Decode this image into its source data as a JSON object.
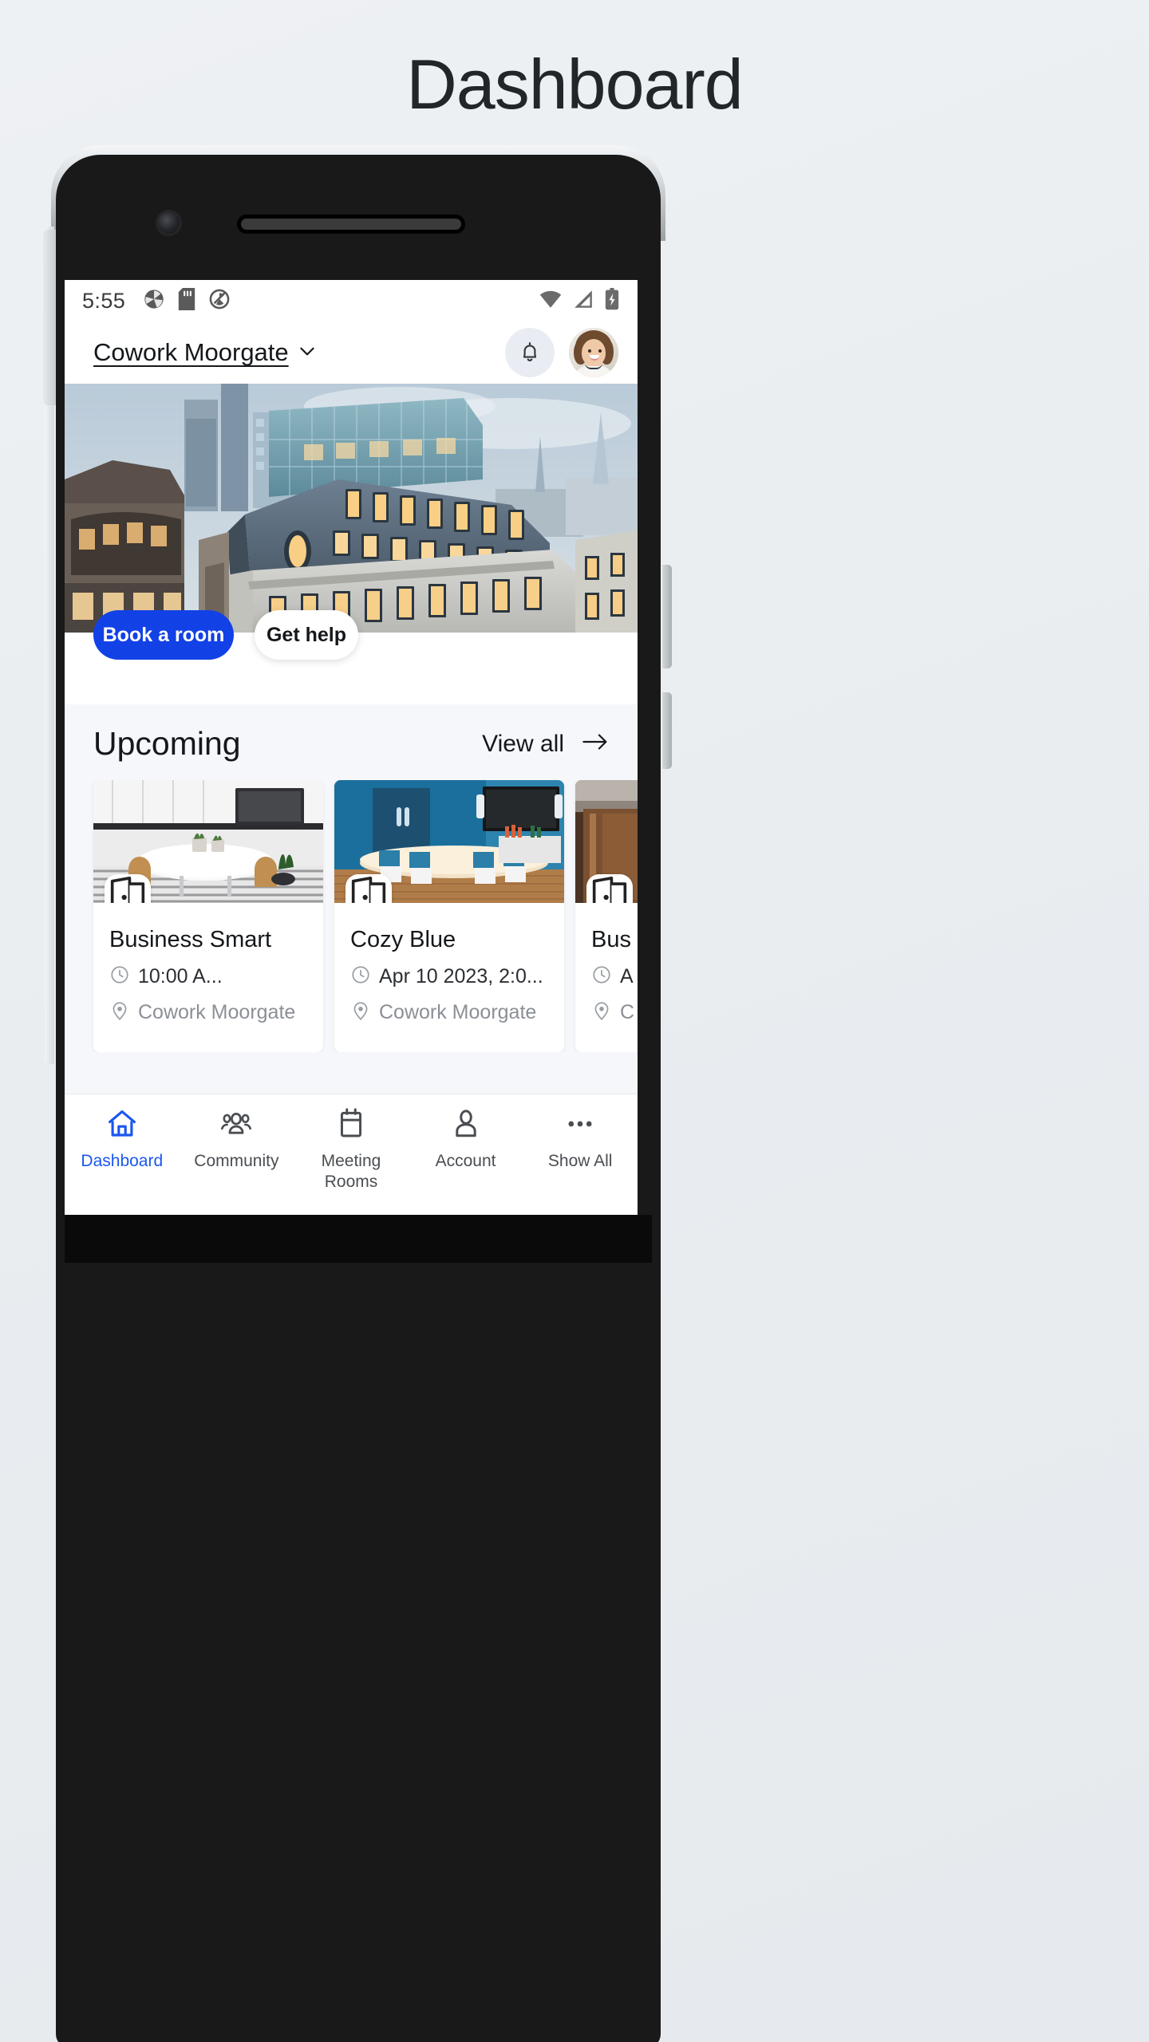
{
  "page": {
    "title": "Dashboard"
  },
  "status_bar": {
    "time": "5:55",
    "left_icons": [
      "camera-app-icon",
      "sd-card-icon",
      "shutter-icon"
    ],
    "right_icons": [
      "wifi-icon",
      "cellular-signal-icon",
      "battery-charging-icon"
    ]
  },
  "app_header": {
    "location_name": "Cowork Moorgate",
    "chevron_icon": "chevron-down-icon",
    "bell_icon": "bell-icon",
    "avatar_alt": "user-avatar"
  },
  "hero": {
    "alt": "aerial-photo-of-office-buildings"
  },
  "cta": {
    "primary_label": "Book a room",
    "secondary_label": "Get help",
    "primary_color": "#1241e6"
  },
  "upcoming": {
    "title": "Upcoming",
    "view_all_label": "View all",
    "arrow_icon": "arrow-right-icon",
    "cards": [
      {
        "title": "Business Smart",
        "time": "10:00 A...",
        "location": "Cowork Moorgate",
        "badge_icon": "open-door-icon",
        "clock_icon": "clock-icon",
        "pin_icon": "location-pin-icon",
        "image_alt": "white-meeting-room-with-plants"
      },
      {
        "title": "Cozy Blue",
        "time": "Apr 10 2023, 2:0...",
        "location": "Cowork Moorgate",
        "badge_icon": "open-door-icon",
        "clock_icon": "clock-icon",
        "pin_icon": "location-pin-icon",
        "image_alt": "blue-meeting-room-with-tv"
      },
      {
        "title": "Bus",
        "time": "A",
        "location": "C",
        "badge_icon": "open-door-icon",
        "clock_icon": "clock-icon",
        "pin_icon": "location-pin-icon",
        "image_alt": "wood-panelled-room"
      }
    ]
  },
  "bottom_nav": {
    "active_color": "#1a56f0",
    "items": [
      {
        "label": "Dashboard",
        "icon": "home-icon",
        "active": true
      },
      {
        "label": "Community",
        "icon": "people-icon",
        "active": false
      },
      {
        "label": "Meeting Rooms",
        "icon": "calendar-icon",
        "active": false
      },
      {
        "label": "Account",
        "icon": "person-icon",
        "active": false
      },
      {
        "label": "Show All",
        "icon": "ellipsis-icon",
        "active": false
      }
    ]
  }
}
